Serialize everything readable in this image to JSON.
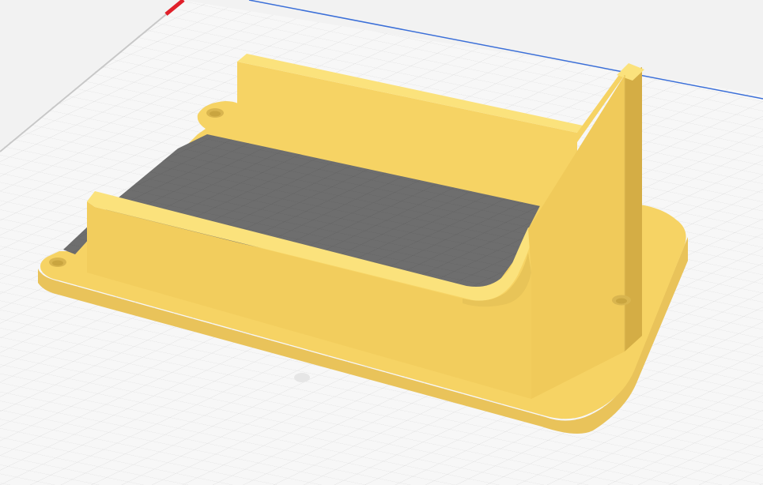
{
  "viewport": {
    "background_color": "#f2f2f2",
    "build_plate_color": "#f7f7f7",
    "grid_minor_color": "#d9d9d9",
    "grid_major_color": "#c8c8c8"
  },
  "axes": {
    "x_axis_color": "#e0202a",
    "y_axis_color": "#3b6fd8"
  },
  "model": {
    "icon": "model-part-icon",
    "base_color": "#f6d364",
    "top_color": "#fbe27c",
    "side_color": "#e9c35a",
    "dark_side_color": "#d4ad45",
    "floor_color": "#6e6e6e",
    "floor_grid_color": "#5e5e5e"
  }
}
